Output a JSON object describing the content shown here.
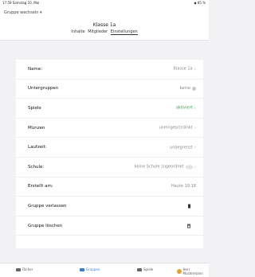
{
  "status_bar": {
    "left": "17:59  Samstag 10. Mai",
    "right": "◆ 85 %"
  },
  "header": {
    "switch_group": "Gruppe wechseln ▾",
    "title": "Klasse 1a",
    "tabs": [
      {
        "label": "Inhalte",
        "active": false
      },
      {
        "label": "Mitglieder",
        "active": false
      },
      {
        "label": "Einstellungen",
        "active": true
      }
    ]
  },
  "settings": {
    "rows": [
      {
        "label": "Name:",
        "value": "Klasse 1a",
        "chevron": "›"
      },
      {
        "label": "Untergruppen",
        "value": "keine",
        "icon": "circle-icon"
      },
      {
        "label": "Spiele",
        "value": "aktiviert",
        "chevron": "›",
        "value_color": "#3aa14a"
      },
      {
        "label": "Münzen",
        "value": "uneingeschränkt",
        "chevron": "›"
      },
      {
        "label": "Laufzeit:",
        "value": "unbegrenzt",
        "chevron": "›"
      },
      {
        "label": "Schule:",
        "value": "keine Schule zugeordnet",
        "icon": "toggle-icon",
        "chevron": "›"
      },
      {
        "label": "Erstellt am:",
        "value": "Heute 19:18"
      },
      {
        "label": "Gruppe verlassen",
        "icon": "leave-door-icon"
      },
      {
        "label": "Gruppe löschen",
        "icon": "trash-icon"
      }
    ]
  },
  "tab_bar": {
    "items": [
      {
        "label": "Fächer",
        "icon": "subjects-icon",
        "active": false
      },
      {
        "label": "Gruppen",
        "icon": "groups-icon",
        "active": true
      },
      {
        "label": "Spiele",
        "icon": "games-icon",
        "active": false
      },
      {
        "label": "Herr Mustermann",
        "icon": "avatar-icon",
        "active": false
      }
    ]
  }
}
